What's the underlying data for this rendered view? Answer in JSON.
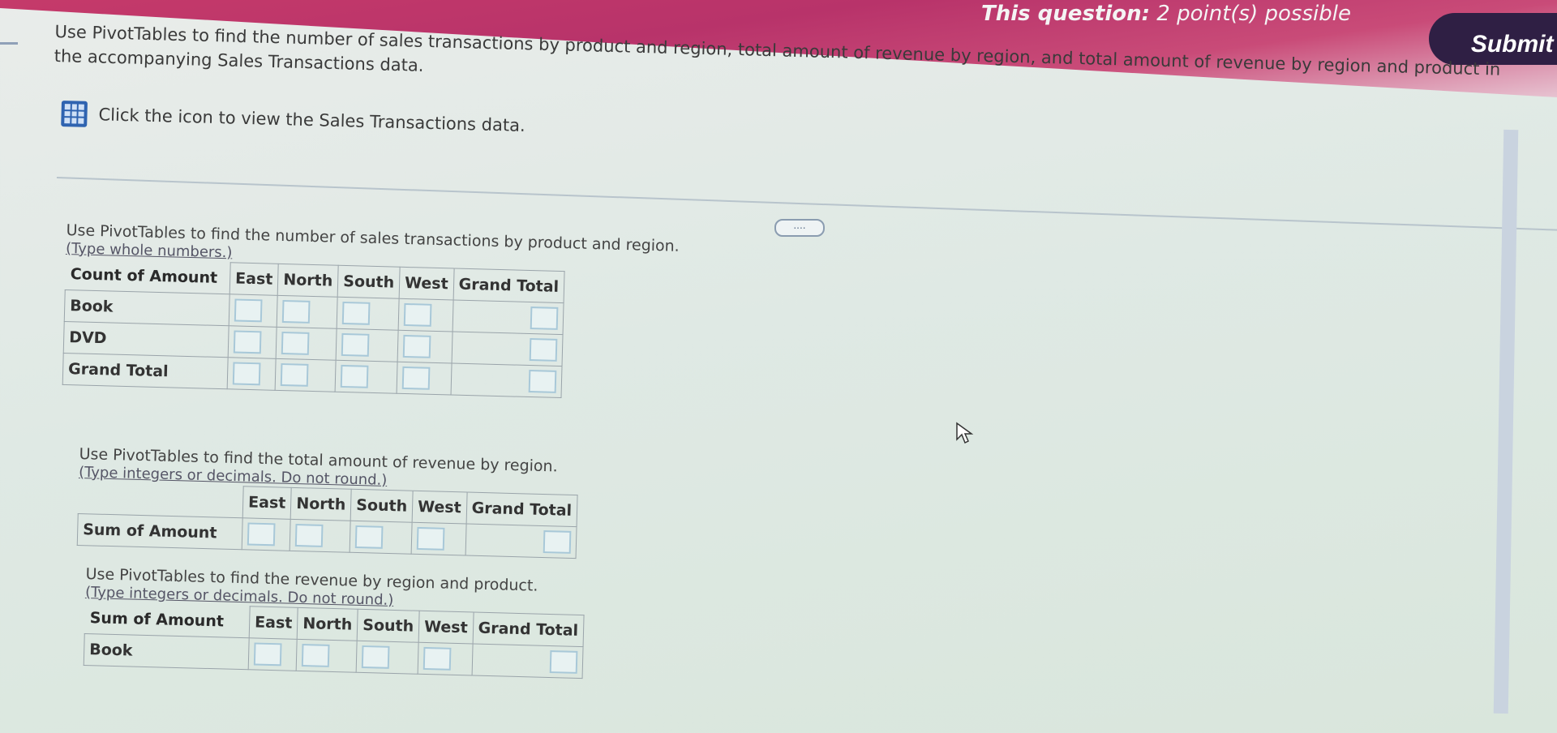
{
  "header": {
    "points_prefix": "This question:",
    "points_text": " 2 point(s) possible",
    "submit_label": "Submit q"
  },
  "intro": {
    "text": "Use PivotTables to find the number of sales transactions by product and region, total amount of revenue by region, and total amount of revenue by region and product in the accompanying Sales Transactions data.",
    "data_link": "Click the icon to view the Sales Transactions data.",
    "icon": "spreadsheet-grid-icon"
  },
  "more_button": "....",
  "count_section": {
    "question": "Use PivotTables to find the number of sales transactions by product and region.",
    "hint": "(Type whole numbers.)",
    "table_title": "Count of Amount",
    "columns": [
      "East",
      "North",
      "South",
      "West",
      "Grand Total"
    ],
    "rows": [
      "Book",
      "DVD",
      "Grand Total"
    ]
  },
  "sum_section": {
    "question": "Use PivotTables to find the total amount of revenue by region.",
    "hint": "(Type integers or decimals. Do not round.)",
    "table_title": "Sum of Amount",
    "columns": [
      "East",
      "North",
      "South",
      "West",
      "Grand Total"
    ]
  },
  "product_section": {
    "question": "Use PivotTables to find the revenue by region and product.",
    "hint": "(Type integers or decimals. Do not round.)",
    "table_title": "Sum of Amount",
    "columns": [
      "East",
      "North",
      "South",
      "West",
      "Grand Total"
    ],
    "rows": [
      "Book"
    ]
  },
  "colors": {
    "header_accent": "#c53a6a",
    "submit_bg": "#2f1f44",
    "icon_blue": "#2f63b0"
  }
}
